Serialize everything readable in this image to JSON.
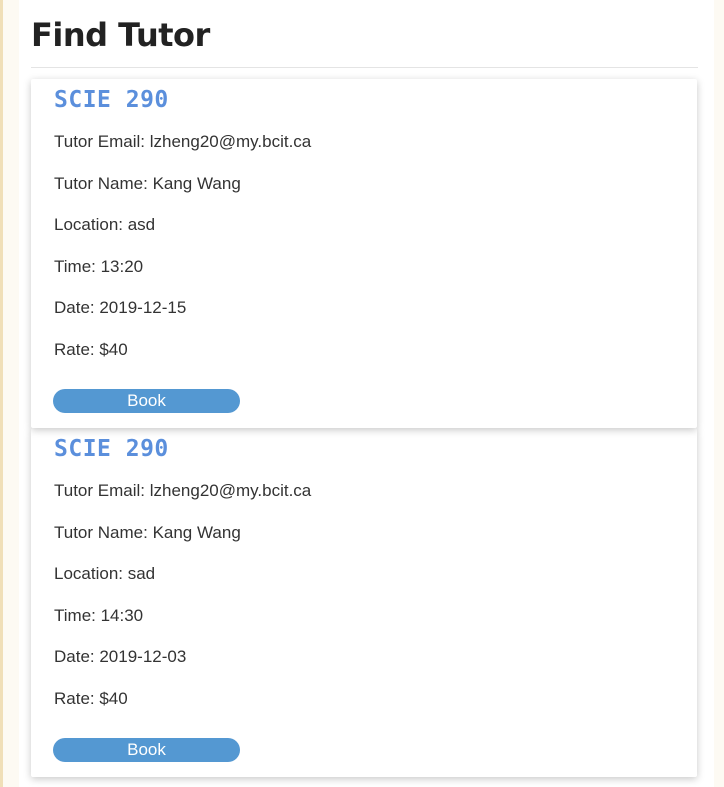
{
  "page": {
    "title": "Find Tutor"
  },
  "tutors": [
    {
      "course": "SCIE 290",
      "email": "Tutor Email: lzheng20@my.bcit.ca",
      "name": "Tutor Name: Kang Wang",
      "location": "Location: asd",
      "time": "Time: 13:20",
      "date": "Date: 2019-12-15",
      "rate": "Rate: $40",
      "book_label": "Book"
    },
    {
      "course": "SCIE 290",
      "email": "Tutor Email: lzheng20@my.bcit.ca",
      "name": "Tutor Name: Kang Wang",
      "location": "Location: sad",
      "time": "Time: 14:30",
      "date": "Date: 2019-12-03",
      "rate": "Rate: $40",
      "book_label": "Book"
    }
  ],
  "colors": {
    "course_heading": "#5b8fdc",
    "book_button": "#5498d2",
    "page_border": "#f0dfb8"
  }
}
